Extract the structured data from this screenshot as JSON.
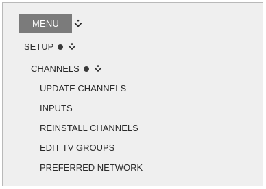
{
  "menu": {
    "label": "MENU"
  },
  "tree": {
    "setup_label": "SETUP",
    "channels_label": "CHANNELS",
    "items": [
      "UPDATE CHANNELS",
      "INPUTS",
      "REINSTALL CHANNELS",
      "EDIT TV GROUPS",
      "PREFERRED NETWORK"
    ]
  },
  "icons": {
    "expand": "chevron-down-icon",
    "selected": "bullet-dot-icon"
  },
  "colors": {
    "background": "#efefef",
    "menu_button": "#7b7b7b",
    "text": "#2b2b2b"
  }
}
